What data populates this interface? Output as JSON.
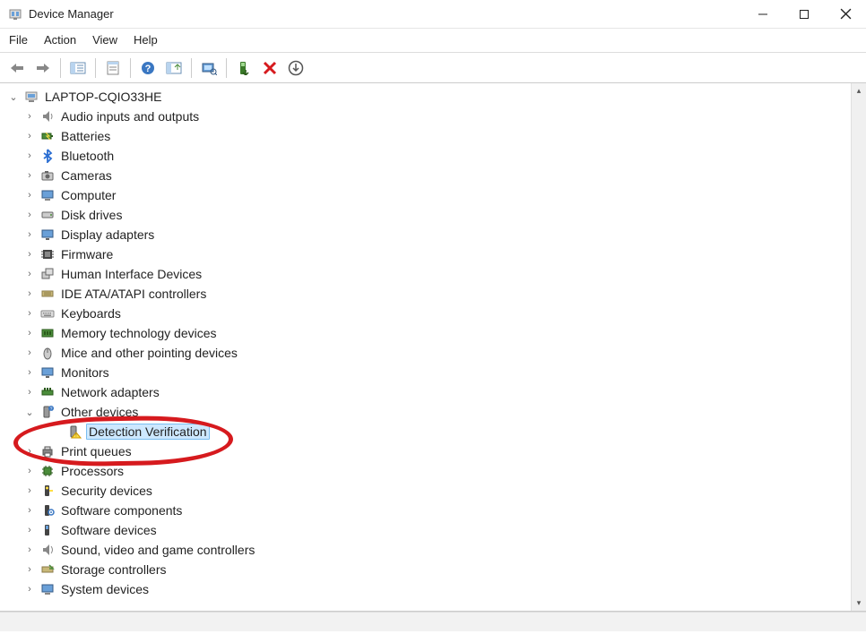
{
  "window": {
    "title": "Device Manager",
    "minimize_tooltip": "Minimize",
    "maximize_tooltip": "Maximize",
    "close_tooltip": "Close"
  },
  "menubar": {
    "file": "File",
    "action": "Action",
    "view": "View",
    "help": "Help"
  },
  "toolbar": {
    "back": "Back",
    "forward": "Forward",
    "show_hide": "Show/Hide Console Tree",
    "properties": "Properties",
    "help": "Help",
    "update_driver": "Update Device Driver",
    "scan": "Scan for hardware changes",
    "enable": "Enable Device",
    "uninstall": "Uninstall Device",
    "add_legacy": "Add Legacy Hardware"
  },
  "tree": {
    "root": "LAPTOP-CQIO33HE",
    "items": [
      {
        "label": "Audio inputs and outputs",
        "icon": "audio"
      },
      {
        "label": "Batteries",
        "icon": "battery"
      },
      {
        "label": "Bluetooth",
        "icon": "bluetooth"
      },
      {
        "label": "Cameras",
        "icon": "camera"
      },
      {
        "label": "Computer",
        "icon": "computer"
      },
      {
        "label": "Disk drives",
        "icon": "disk"
      },
      {
        "label": "Display adapters",
        "icon": "display"
      },
      {
        "label": "Firmware",
        "icon": "firmware"
      },
      {
        "label": "Human Interface Devices",
        "icon": "hid"
      },
      {
        "label": "IDE ATA/ATAPI controllers",
        "icon": "ide"
      },
      {
        "label": "Keyboards",
        "icon": "keyboard"
      },
      {
        "label": "Memory technology devices",
        "icon": "memory"
      },
      {
        "label": "Mice and other pointing devices",
        "icon": "mouse"
      },
      {
        "label": "Monitors",
        "icon": "monitor"
      },
      {
        "label": "Network adapters",
        "icon": "network"
      },
      {
        "label": "Other devices",
        "icon": "other",
        "expanded": true,
        "children": [
          {
            "label": "Detection Verification",
            "icon": "unknown-warn",
            "selected": true
          }
        ]
      },
      {
        "label": "Print queues",
        "icon": "printer"
      },
      {
        "label": "Processors",
        "icon": "processor"
      },
      {
        "label": "Security devices",
        "icon": "security"
      },
      {
        "label": "Software components",
        "icon": "swcomp"
      },
      {
        "label": "Software devices",
        "icon": "swdev"
      },
      {
        "label": "Sound, video and game controllers",
        "icon": "sound"
      },
      {
        "label": "Storage controllers",
        "icon": "storage"
      },
      {
        "label": "System devices",
        "icon": "system"
      }
    ]
  }
}
